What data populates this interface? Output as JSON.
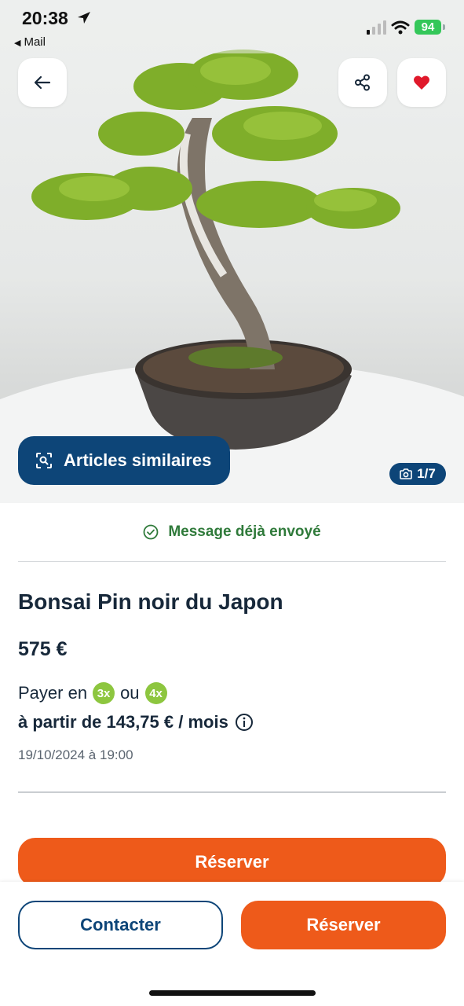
{
  "status_bar": {
    "time": "20:38",
    "back_app": "Mail",
    "battery": "94"
  },
  "icons": {
    "back": "arrow-left-icon",
    "share": "share-icon",
    "favorite": "heart-icon",
    "similar": "visual-search-icon",
    "camera": "camera-icon",
    "check": "check-circle-icon",
    "info": "info-icon"
  },
  "hero": {
    "similar_label": "Articles similaires",
    "photo_counter": "1/7"
  },
  "listing": {
    "message_status": "Message déjà envoyé",
    "title": "Bonsai Pin noir du Japon",
    "price": "575 €",
    "pay_prefix": "Payer en",
    "pay_option_1": "3x",
    "pay_or": "ou",
    "pay_option_2": "4x",
    "per_month": "à partir de 143,75 € / mois",
    "date": "19/10/2024 à 19:00",
    "reserve_label": "Réserver"
  },
  "footer": {
    "contact_label": "Contacter",
    "reserve_label": "Réserver"
  },
  "colors": {
    "navy": "#0d4578",
    "orange": "#ee5a1a",
    "green_text": "#2f7a3a",
    "badge_green": "#8dc63f",
    "heart_red": "#e0192b"
  }
}
